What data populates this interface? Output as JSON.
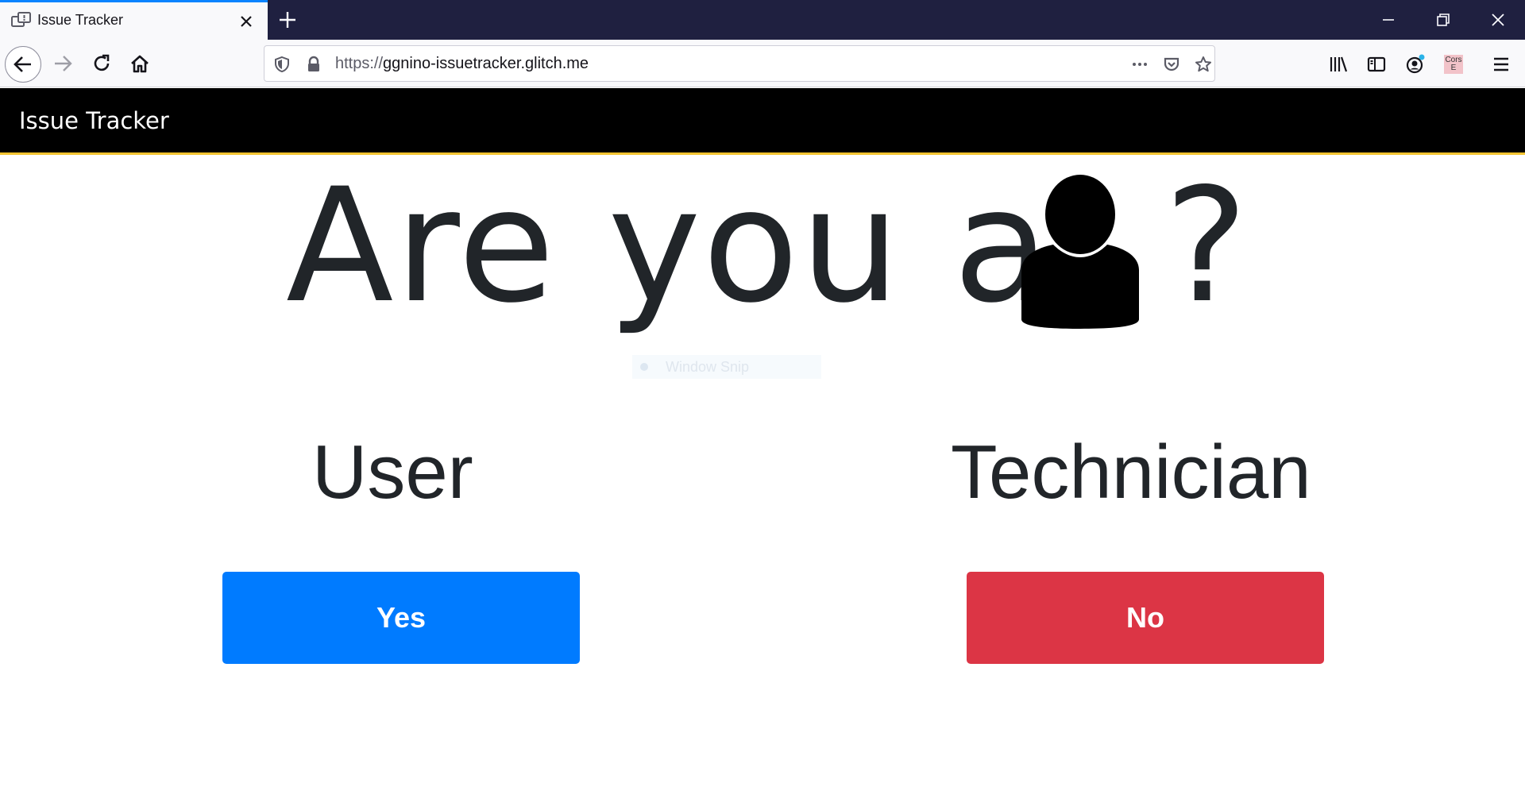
{
  "browser": {
    "tab": {
      "title": "Issue Tracker",
      "icon": "feedback-icon"
    },
    "url": {
      "protocol": "https://",
      "host": "ggnino-issuetracker.glitch.me"
    },
    "extension_badge": "Cors E"
  },
  "page": {
    "brand": "Issue Tracker",
    "headline": {
      "text": "Are you a",
      "question_mark": "?",
      "icon": "person-icon"
    },
    "overlay": {
      "label": "Window Snip"
    },
    "roles": [
      {
        "label": "User",
        "button_label": "Yes",
        "button_color": "#007bff"
      },
      {
        "label": "Technician",
        "button_label": "No",
        "button_color": "#dc3545"
      }
    ]
  },
  "colors": {
    "header_bg": "#000000",
    "header_accent": "#f4c430",
    "text": "#212529",
    "titlebar": "#1f2040"
  }
}
